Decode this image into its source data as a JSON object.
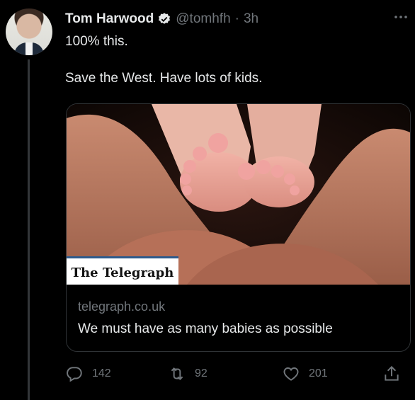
{
  "tweet": {
    "author_name": "Tom Harwood",
    "handle": "@tomhfh",
    "separator": "·",
    "time": "3h",
    "text": "100% this.\n\nSave the West. Have lots of kids."
  },
  "card": {
    "publisher_logo_text": "The Telegraph",
    "domain": "telegraph.co.uk",
    "title": "We must have as many babies as possible"
  },
  "actions": {
    "reply_count": "142",
    "retweet_count": "92",
    "like_count": "201"
  },
  "colors": {
    "background": "#000000",
    "text_primary": "#e7e9ea",
    "text_secondary": "#71767b",
    "border": "#2f3336",
    "verified_blue": "#e7e9ea"
  },
  "icons": [
    "more-icon",
    "verified-icon",
    "reply-icon",
    "retweet-icon",
    "like-icon",
    "share-icon"
  ]
}
